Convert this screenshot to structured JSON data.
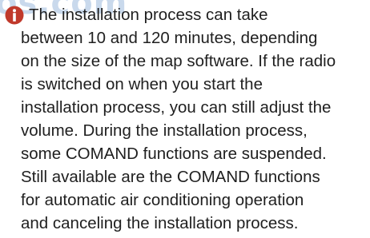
{
  "watermark": {
    "text": "os.com"
  },
  "icon": "info-icon",
  "colors": {
    "icon": "#c0392b",
    "watermark": "#c9d9ec",
    "text": "#1f1f1f"
  },
  "note": {
    "lines": [
      "The installation process can take",
      "between 10 and 120 minutes, depending",
      "on the size of the map software. If the radio",
      "is switched on when you start the",
      "installation process, you can still adjust the",
      "volume. During the installation process,",
      "some COMAND functions are suspended.",
      "Still available are the COMAND functions",
      "for automatic air conditioning operation",
      "and canceling the installation process."
    ]
  }
}
